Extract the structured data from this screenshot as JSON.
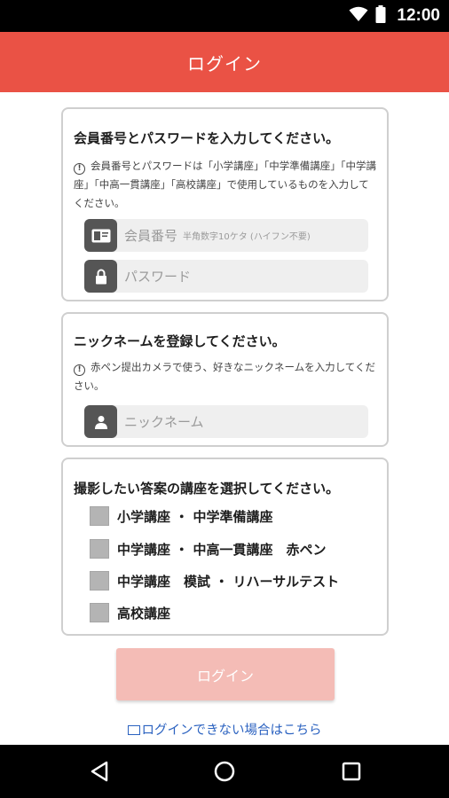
{
  "status_bar": {
    "time": "12:00"
  },
  "app_bar": {
    "title": "ログイン"
  },
  "member_card": {
    "heading": "会員番号とパスワードを入力してください。",
    "note": "会員番号とパスワードは「小学講座」「中学準備講座」「中学講座」「中高一貫講座」「高校講座」で使用しているものを入力してください。",
    "member_field": {
      "placeholder": "会員番号",
      "hint": "半角数字10ケタ (ハイフン不要)",
      "icon": "id-card-icon"
    },
    "password_field": {
      "placeholder": "パスワード",
      "icon": "lock-icon"
    }
  },
  "nickname_card": {
    "heading": "ニックネームを登録してください。",
    "note": "赤ペン提出カメラで使う、好きなニックネームを入力してください。",
    "nickname_field": {
      "placeholder": "ニックネーム",
      "icon": "person-icon"
    }
  },
  "course_card": {
    "heading": "撮影したい答案の講座を選択してください。",
    "options": [
      {
        "label": "小学講座 ・ 中学準備講座",
        "checked": false
      },
      {
        "label": "中学講座 ・ 中高一貫講座　赤ペン",
        "checked": false
      },
      {
        "label": "中学講座　模試 ・ リハーサルテスト",
        "checked": false
      },
      {
        "label": "高校講座",
        "checked": false
      }
    ]
  },
  "login_button": {
    "label": "ログイン",
    "enabled": false
  },
  "help_link": {
    "label": "ログインできない場合はこちら"
  },
  "colors": {
    "accent": "#ea5245",
    "button_disabled": "#f4bcb6",
    "link": "#2b62c0"
  }
}
